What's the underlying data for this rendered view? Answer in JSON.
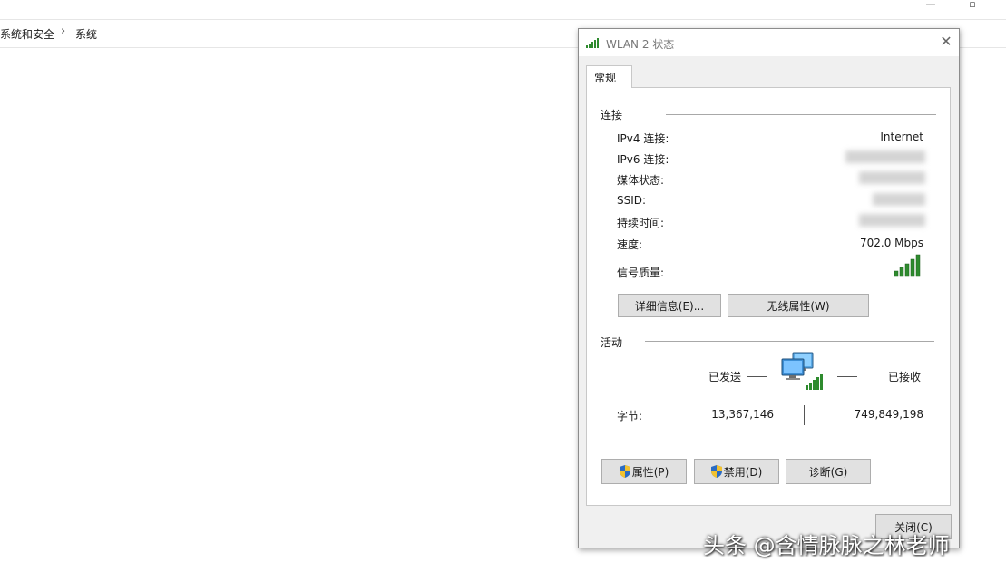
{
  "explorer": {
    "breadcrumb": [
      "系统和安全",
      "系统"
    ],
    "breadcrumb_separator": "›"
  },
  "dialog": {
    "title": "WLAN 2 状态",
    "close_glyph": "✕",
    "tab_general": "常规",
    "connection": {
      "section_title": "连接",
      "rows": [
        {
          "label": "IPv4 连接:",
          "value": "Internet"
        },
        {
          "label": "IPv6 连接:",
          "value": ""
        },
        {
          "label": "媒体状态:",
          "value": ""
        },
        {
          "label": "SSID:",
          "value": ""
        },
        {
          "label": "持续时间:",
          "value": ""
        },
        {
          "label": "速度:",
          "value": "702.0 Mbps"
        },
        {
          "label": "信号质量:",
          "value": ""
        }
      ],
      "signal_bars_lit": 5,
      "signal_bars_total": 5,
      "details_button": "详细信息(E)...",
      "wireless_props_button": "无线属性(W)"
    },
    "activity": {
      "section_title": "活动",
      "sent_label": "已发送",
      "received_label": "已接收",
      "bytes_label": "字节:",
      "bytes_sent": "13,367,146",
      "bytes_received": "749,849,198"
    },
    "buttons": {
      "properties": "属性(P)",
      "disable": "禁用(D)",
      "diagnose": "诊断(G)",
      "close": "关闭(C)"
    }
  },
  "watermark": "头条 @含情脉脉之林老师",
  "colors": {
    "signal_green": "#2e8b2e",
    "dialog_bg": "#f0f0f0",
    "button_bg": "#e1e1e1",
    "shield_blue": "#2b6cc4",
    "shield_yellow": "#f2c230"
  }
}
